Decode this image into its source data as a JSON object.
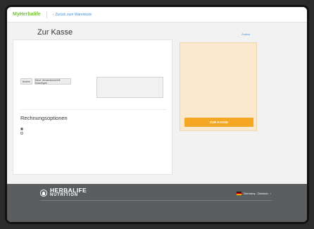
{
  "header": {
    "logo": "MyHerbalife",
    "back_link": "Zurück zum Warenkorb"
  },
  "page": {
    "title": "Zur Kasse",
    "back_top": "Zurück"
  },
  "shipping": {
    "sender_label": "",
    "delivery_label": "",
    "btn_edit": "Ändern",
    "btn_new_address": "Neue Versandanschrift hinzufügen",
    "notes_placeholder": ""
  },
  "billing": {
    "title": "Rechnungsoptionen",
    "option_label": "",
    "options": [
      "",
      ""
    ]
  },
  "summary": {
    "checkout_button": "ZUR KASSE"
  },
  "footer": {
    "brand_top": "HERBALIFE",
    "brand_bottom": "NUTRITION",
    "language": "Germany - Deutsch"
  },
  "colors": {
    "accent_green": "#7ac143",
    "checkout_orange": "#f5a623",
    "summary_bg": "#fbe9cf",
    "footer_bg": "#5b5e60",
    "link_blue": "#3a8fd9"
  }
}
